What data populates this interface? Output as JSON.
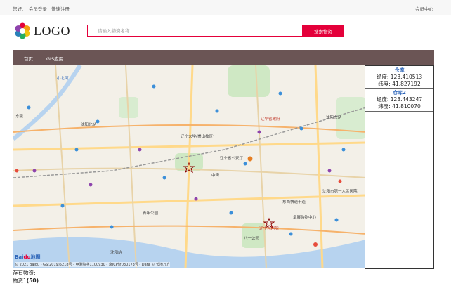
{
  "topbar": {
    "greeting": "您好,",
    "login": "会员登录",
    "register": "快速注册",
    "member_center": "会员中心"
  },
  "logo": {
    "text": "LOGO"
  },
  "search": {
    "placeholder": "请输入物资名称",
    "button": "搜索物资",
    "value": ""
  },
  "nav": {
    "items": [
      {
        "label": "首页"
      },
      {
        "label": "GIS应用"
      }
    ]
  },
  "map": {
    "provider": "Baidu",
    "copyright": "© 2021 Baidu - GS(2019)5218号 - 甲测资字1100930 - 京ICP证030173号 - Data © 长地万方",
    "labels": [
      "东陵",
      "小北河",
      "辽宁大学(崇山校区)",
      "辽宁省公安厅",
      "东西快速干道",
      "辽宁大剧院",
      "沈阳北站",
      "青年公园",
      "八一公园",
      "中街",
      "卓展购物中心",
      "辽宁省政府",
      "沈阳东站",
      "沈阳市第一人民医院",
      "沈阳站"
    ]
  },
  "warehouses": [
    {
      "name": "仓库",
      "lng_label": "经度:",
      "lng": "123.410513",
      "lat_label": "纬度:",
      "lat": "41.827192"
    },
    {
      "name": "仓库2",
      "lng_label": "经度:",
      "lng": "123.443247",
      "lat_label": "纬度:",
      "lat": "41.810070"
    }
  ],
  "inventory": {
    "label": "存有物资:",
    "item_name": "物资1",
    "item_qty": "(50)"
  }
}
